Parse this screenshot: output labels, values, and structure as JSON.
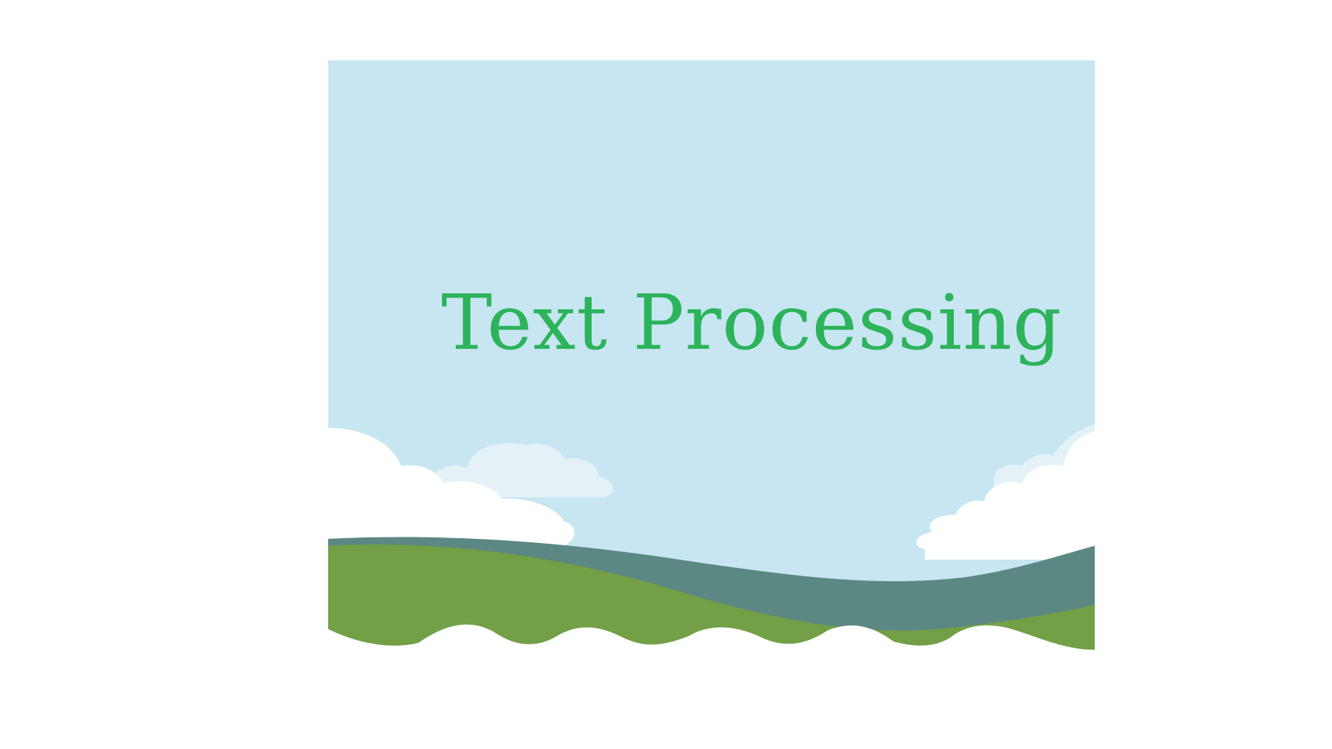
{
  "slide": {
    "title": "Text Processing"
  },
  "colors": {
    "page_background": "#ffffff",
    "sky": "#c7e6f1",
    "cloud_front": "#ffffff",
    "cloud_back": "#e4f2f7",
    "far_hill": "#5b8882",
    "near_hill": "#739f47",
    "title_text": "#2db35b"
  }
}
